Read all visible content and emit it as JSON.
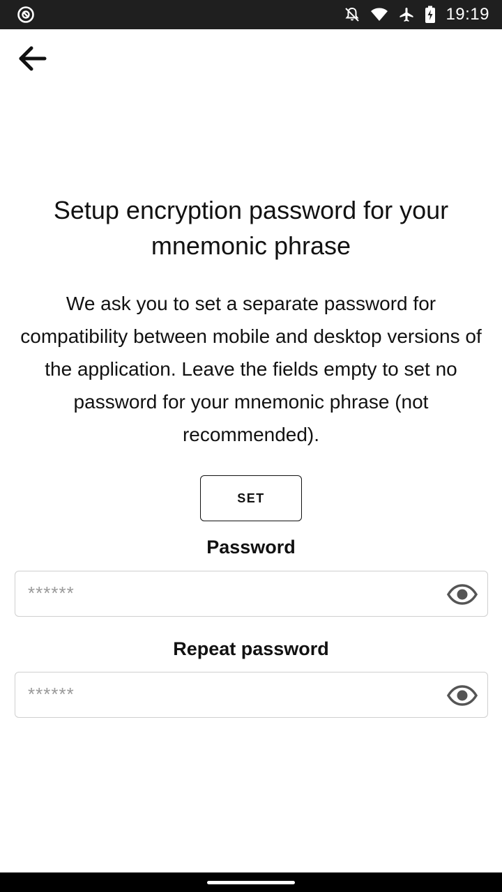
{
  "status_bar": {
    "time": "19:19",
    "icons": [
      "app-notification-icon",
      "do-not-disturb-icon",
      "wifi-icon",
      "airplane-mode-icon",
      "battery-charging-icon"
    ]
  },
  "header": {
    "back_icon": "arrow-left-icon"
  },
  "main": {
    "title": "Setup encryption password for your mnemonic phrase",
    "description": "We ask you to set a separate password for compatibility between mobile and desktop versions of the application. Leave the fields empty to set no password for your mnemonic phrase (not recommended).",
    "set_button_label": "SET"
  },
  "form": {
    "password": {
      "label": "Password",
      "value": "",
      "placeholder": "******",
      "toggle_icon": "eye-icon"
    },
    "repeat_password": {
      "label": "Repeat password",
      "value": "",
      "placeholder": "******",
      "toggle_icon": "eye-icon"
    }
  },
  "colors": {
    "status_bar_bg": "#1f1f1f",
    "text": "#111111",
    "field_border": "#cfcfcf",
    "placeholder": "#9a9a9a",
    "nav_bar_bg": "#000000"
  }
}
